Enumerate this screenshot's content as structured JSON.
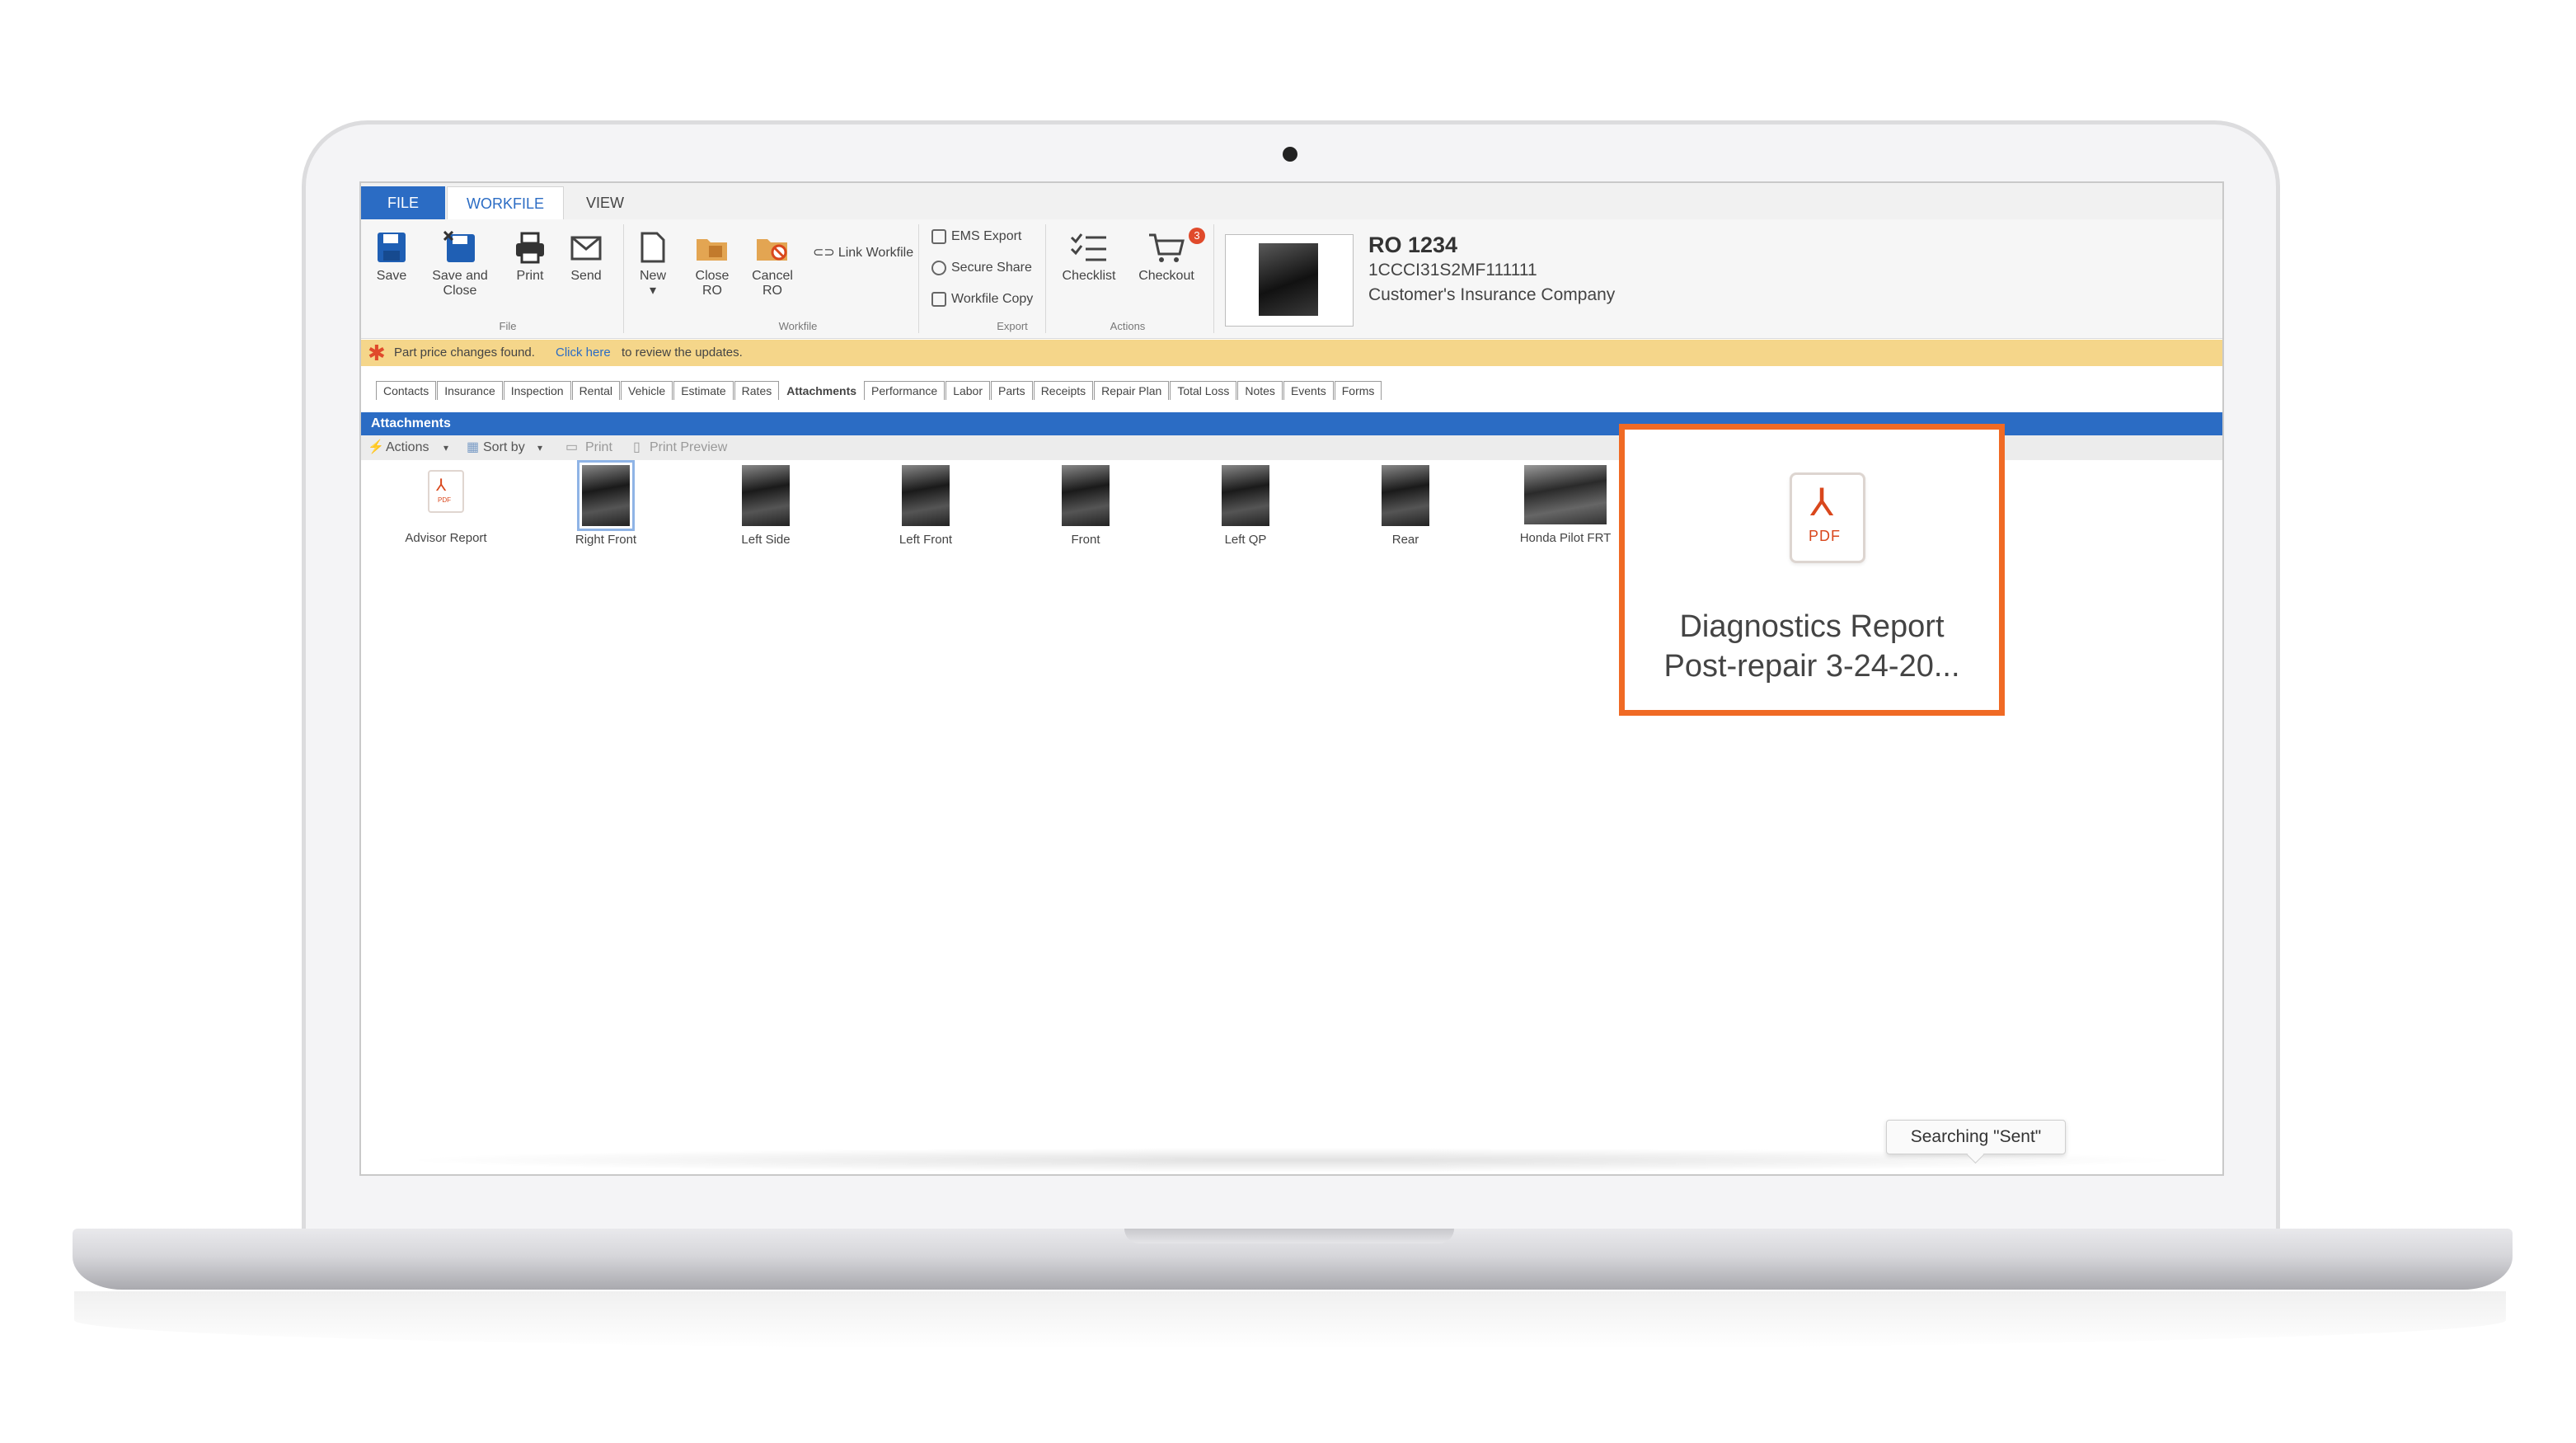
{
  "ribbon": {
    "tabs": [
      "FILE",
      "WORKFILE",
      "VIEW"
    ],
    "file_group": {
      "save": "Save",
      "save_close_1": "Save and",
      "save_close_2": "Close",
      "print": "Print",
      "send": "Send",
      "label": "File"
    },
    "workfile_group": {
      "new": "New",
      "close_ro_1": "Close",
      "close_ro_2": "RO",
      "cancel_ro_1": "Cancel",
      "cancel_ro_2": "RO",
      "link_workfile": "Link Workfile",
      "label": "Workfile"
    },
    "export_group": {
      "ems_export": "EMS Export",
      "secure_share": "Secure Share",
      "workfile_copy": "Workfile Copy",
      "label": "Export"
    },
    "actions_group": {
      "checklist": "Checklist",
      "checkout": "Checkout",
      "checkout_badge": "3",
      "label": "Actions"
    }
  },
  "ro": {
    "title": "RO 1234",
    "vin": "1CCCI31S2MF111111",
    "insurer": "Customer's Insurance Company"
  },
  "notice": {
    "message": "Part price changes found.",
    "link": "Click here",
    "message2": "to review the updates."
  },
  "subtabs": [
    "Contacts",
    "Insurance",
    "Inspection",
    "Rental",
    "Vehicle",
    "Estimate",
    "Rates",
    "Attachments",
    "Performance",
    "Labor",
    "Parts",
    "Receipts",
    "Repair Plan",
    "Total Loss",
    "Notes",
    "Events",
    "Forms"
  ],
  "section": {
    "title": "Attachments"
  },
  "toolbar": {
    "actions": "Actions",
    "sort_by": "Sort by",
    "print": "Print",
    "print_preview": "Print Preview"
  },
  "attachments": [
    "Advisor Report",
    "Right Front",
    "Left Side",
    "Left Front",
    "Front",
    "Left QP",
    "Rear",
    "Honda Pilot FRT"
  ],
  "callout": {
    "pdf_label": "PDF",
    "line1": "Diagnostics Report",
    "line2": "Post-repair 3-24-20..."
  },
  "tooltip": {
    "text": "Searching \"Sent\""
  },
  "colors": {
    "accent": "#2b6cc4",
    "highlight": "#f06a24",
    "notice": "#f5d68a"
  }
}
